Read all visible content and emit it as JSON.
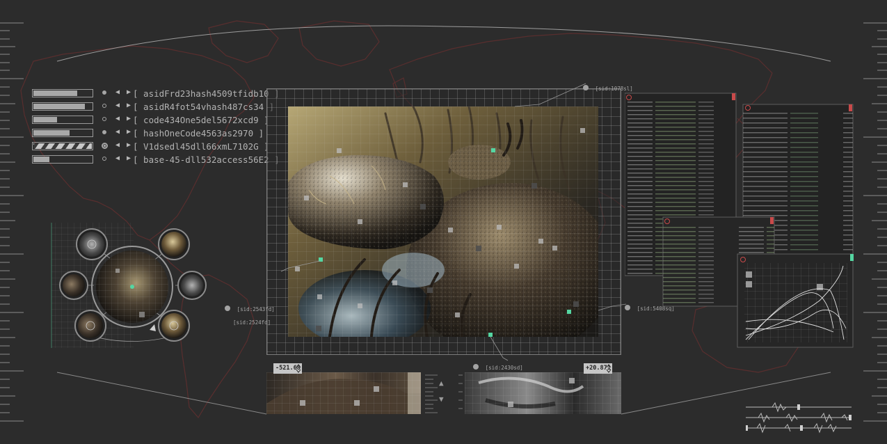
{
  "ids": [
    {
      "label": "[ asidFrd23hash4509tfidb10 ]",
      "fill": 0.75,
      "dot": "filled",
      "pattern": "solid"
    },
    {
      "label": "[ asidR4fot54vhash487cs34 ]",
      "fill": 0.88,
      "dot": "empty",
      "pattern": "solid"
    },
    {
      "label": "[ code434One5del5672xcd9 ]",
      "fill": 0.4,
      "dot": "empty",
      "pattern": "solid"
    },
    {
      "label": "[ hashOneCode4563as2970 ]",
      "fill": 0.62,
      "dot": "filled",
      "pattern": "solid"
    },
    {
      "label": "[ V1dsedl45dll66xmL7102G ]",
      "fill": 1.0,
      "dot": "target",
      "pattern": "hatched"
    },
    {
      "label": "[ base-45-dll532access56E2 ]",
      "fill": 0.27,
      "dot": "empty",
      "pattern": "solid"
    }
  ],
  "sids": {
    "top": "[sid:1078sl]",
    "left_1": "[sid:2543fd]",
    "left_2": "[sid:2524fd]",
    "right": "[sid:5408sq]",
    "bottom": "[sid:2430sd]"
  },
  "readouts": {
    "left": "-521.68",
    "right": "+20.871"
  },
  "icons": {
    "id_arrows": "◀ ▶",
    "scroll_up": "▲",
    "scroll_down": "▼"
  },
  "colors": {
    "accent": "#55d6a2",
    "alert": "#c94a4a",
    "map_line": "#5a2c2c",
    "panel_border": "#7c7c7c"
  }
}
